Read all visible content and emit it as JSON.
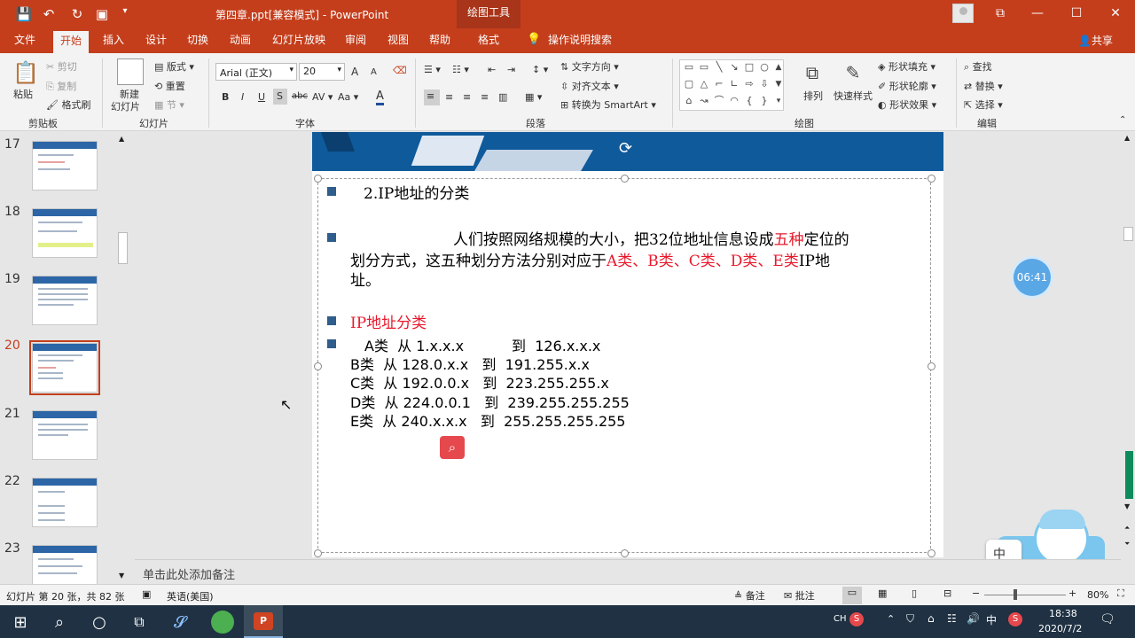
{
  "titlebar": {
    "doc_title": "第四章.ppt[兼容模式] - PowerPoint",
    "context_tab": "绘图工具",
    "min": "—",
    "max": "☐",
    "close": "✕",
    "restore": "⧉"
  },
  "tabs": [
    "文件",
    "开始",
    "插入",
    "设计",
    "切换",
    "动画",
    "幻灯片放映",
    "审阅",
    "视图",
    "帮助",
    "格式"
  ],
  "tell_me": "操作说明搜索",
  "share": "共享",
  "ribbon": {
    "clipboard": {
      "paste": "粘贴",
      "cut": "剪切",
      "copy": "复制",
      "format_painter": "格式刷",
      "label": "剪贴板"
    },
    "slides": {
      "new_slide": "新建",
      "new_slide2": "幻灯片",
      "layout": "版式",
      "reset": "重置",
      "section": "节",
      "label": "幻灯片"
    },
    "font": {
      "family": "Arial (正文)",
      "size": "20",
      "label": "字体",
      "bold": "B",
      "italic": "I",
      "underline": "U",
      "shadow": "S",
      "strike": "abc",
      "spacing": "AV",
      "case": "Aa",
      "grow": "A",
      "shrink": "A",
      "clear": "A",
      "color": "A"
    },
    "paragraph": {
      "text_direction": "文字方向",
      "align_text": "对齐文本",
      "smartart": "转换为 SmartArt",
      "label": "段落"
    },
    "drawing": {
      "arrange": "排列",
      "quick_styles": "快速样式",
      "shape_fill": "形状填充",
      "shape_outline": "形状轮廓",
      "shape_effects": "形状效果",
      "label": "绘图"
    },
    "editing": {
      "find": "查找",
      "replace": "替换",
      "select": "选择",
      "label": "编辑"
    }
  },
  "thumbnails": [
    {
      "num": "17"
    },
    {
      "num": "18"
    },
    {
      "num": "19"
    },
    {
      "num": "20"
    },
    {
      "num": "21"
    },
    {
      "num": "22"
    },
    {
      "num": "23"
    }
  ],
  "slide": {
    "heading": "2.IP地址的分类",
    "para_line1_a": "人们按照网络规模的大小，把32位地址信息设成",
    "para_line1_red": "五种",
    "para_line1_b": "定位的",
    "para_line2_a": "划分方式，这五种划分方法分别对应于",
    "para_line2_red": "A类、B类、C类、D类、E类",
    "para_line2_b": "IP地",
    "para_line3": "址。",
    "subheading": "IP地址分类",
    "rows": [
      {
        "cls": "A类",
        "from": "从",
        "start": "1.x.x.x",
        "to": "到",
        "end": "126.x.x.x"
      },
      {
        "cls": "B类",
        "from": "从",
        "start": "128.0.x.x",
        "to": "到",
        "end": "191.255.x.x"
      },
      {
        "cls": "C类",
        "from": "从",
        "start": "192.0.0.x",
        "to": "到",
        "end": "223.255.255.x"
      },
      {
        "cls": "D类",
        "from": "从",
        "start": "224.0.0.1",
        "to": "到",
        "end": "239.255.255.255"
      },
      {
        "cls": "E类",
        "from": "从",
        "start": "240.x.x.x",
        "to": "到",
        "end": "255.255.255.255"
      }
    ]
  },
  "timer": "06:41",
  "sticker_text": "中",
  "notes_placeholder": "单击此处添加备注",
  "status": {
    "slide_info": "幻灯片 第 20 张，共 82 张",
    "language": "英语(美国)",
    "notes": "备注",
    "comments": "批注",
    "zoom": "80%"
  },
  "taskbar": {
    "ime": "CH",
    "ime2": "中",
    "time": "18:38",
    "date": "2020/7/2"
  },
  "colors": {
    "accent": "#c43e1c",
    "banner": "#0f5a9b",
    "red_text": "#e8192c",
    "bullet": "#2f5d8c"
  }
}
